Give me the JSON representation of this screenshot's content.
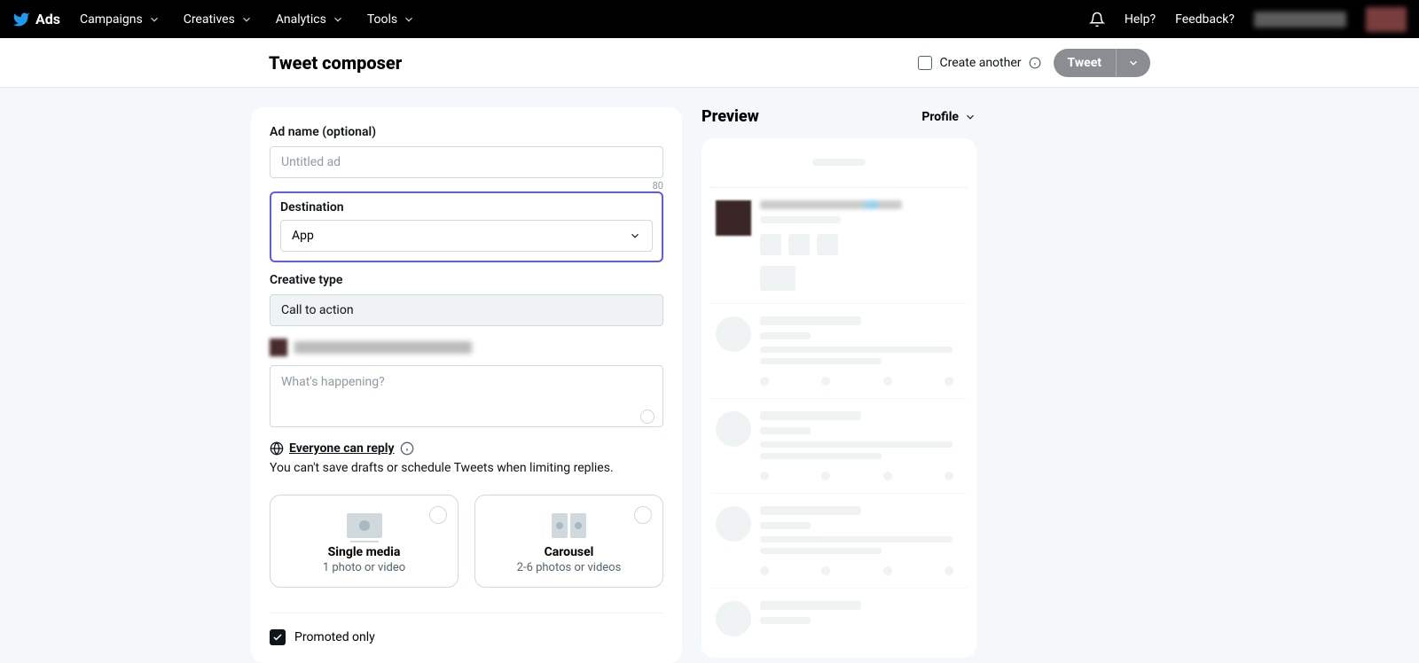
{
  "nav": {
    "brand": "Ads",
    "items": [
      "Campaigns",
      "Creatives",
      "Analytics",
      "Tools"
    ],
    "help": "Help?",
    "feedback": "Feedback?"
  },
  "header": {
    "title": "Tweet composer",
    "create_another": "Create another",
    "tweet_button": "Tweet"
  },
  "form": {
    "ad_name_label": "Ad name (optional)",
    "ad_name_placeholder": "Untitled ad",
    "ad_name_count": "80",
    "destination_label": "Destination",
    "destination_value": "App",
    "creative_type_label": "Creative type",
    "creative_type_value": "Call to action",
    "tweet_placeholder": "What's happening?",
    "reply_setting": "Everyone can reply",
    "reply_note": "You can't save drafts or schedule Tweets when limiting replies.",
    "media": {
      "single_title": "Single media",
      "single_sub": "1 photo or video",
      "carousel_title": "Carousel",
      "carousel_sub": "2-6 photos or videos"
    },
    "promoted_only": "Promoted only"
  },
  "preview": {
    "title": "Preview",
    "mode": "Profile"
  }
}
